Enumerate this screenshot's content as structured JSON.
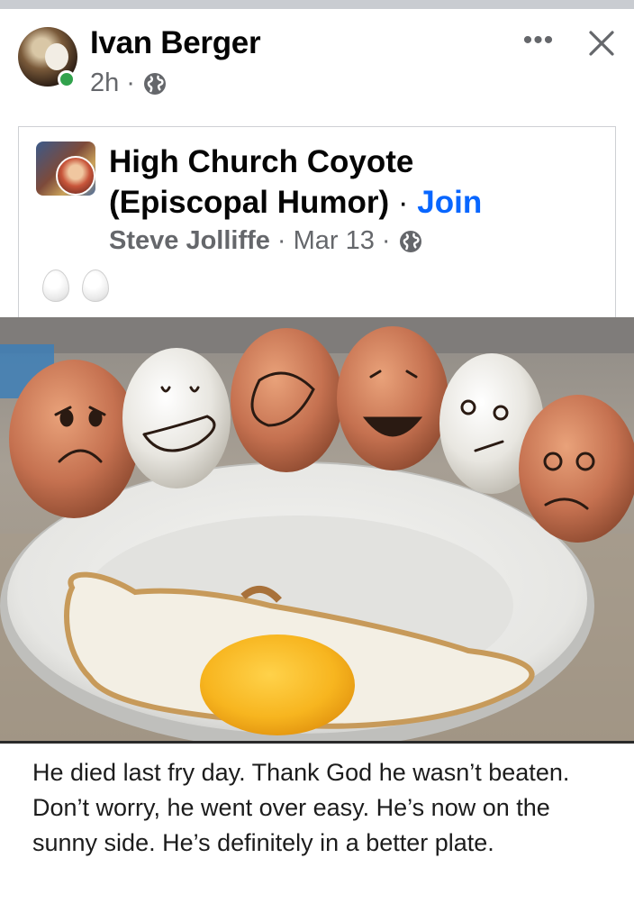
{
  "post": {
    "author": "Ivan Berger",
    "time": "2h",
    "meta_separator": "·",
    "audience_icon": "globe-icon",
    "more_icon": "ellipsis-icon",
    "more_glyph": "•••",
    "close_icon": "close-icon"
  },
  "shared": {
    "group_name": "High Church Coyote (Episcopal Humor)",
    "separator": "·",
    "join_label": "Join",
    "poster": "Steve Jolliffe",
    "date": "Mar 13",
    "meta_separator": "·",
    "audience_icon": "globe-icon",
    "emoji": [
      "egg-emoji",
      "egg-emoji"
    ]
  },
  "meme": {
    "caption": "He died last fry day. Thank God he wasn’t beaten. Don’t worry, he went over easy. He’s now on the sunny side. He’s definitely in a better plate."
  },
  "colors": {
    "link_blue": "#0866ff",
    "online_green": "#31a24c",
    "secondary_text": "#65676b"
  }
}
